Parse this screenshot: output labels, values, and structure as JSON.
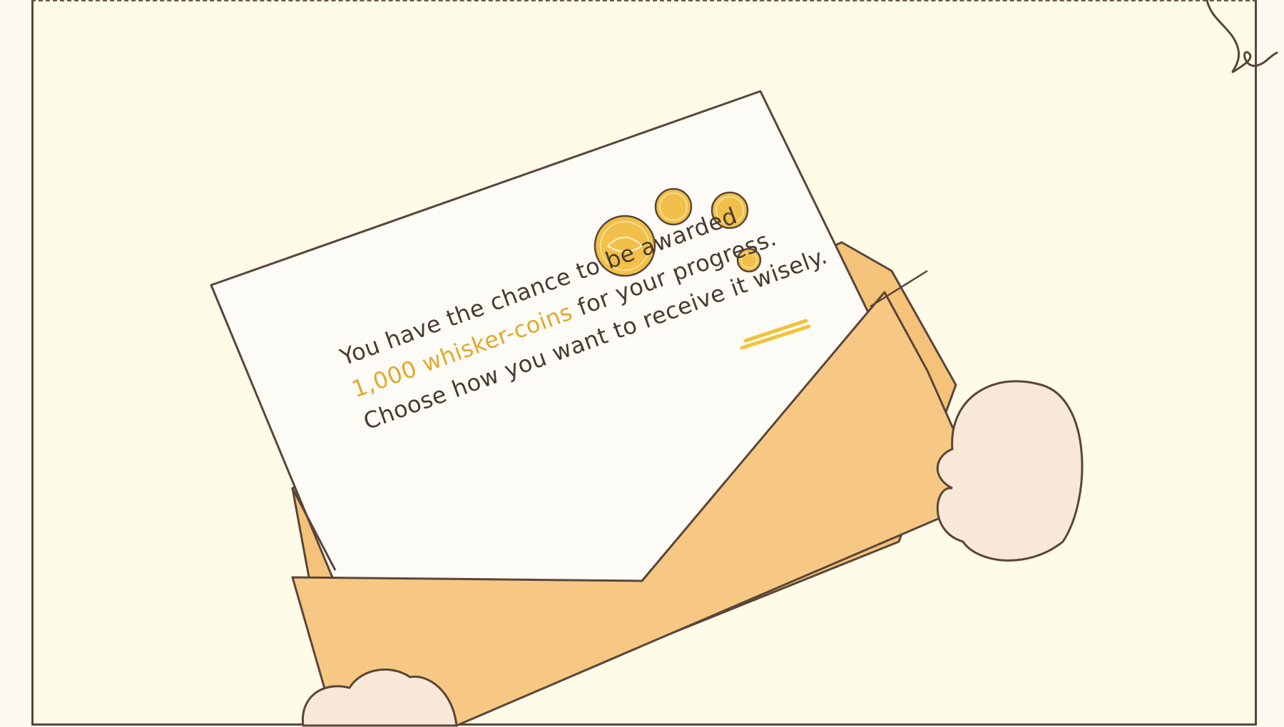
{
  "letter": {
    "line1": "You have the chance to be awarded",
    "line2_highlight": "1,000 whisker-coins",
    "line2_rest": " for your progress.",
    "line3_start": "Choose how you want to receive it ",
    "line3_underlined": "wisely."
  },
  "colors": {
    "background": "#fefbe8",
    "outline": "#5a4638",
    "envelope": "#f7c883",
    "letter_paper": "#fdfbf6",
    "coin": "#f1c04a",
    "paw": "#f7e8d8",
    "highlight_text": "#e0a92a",
    "body_text": "#4a3a2d"
  },
  "icons": [
    "coin-icon",
    "paw-icon",
    "curl-decoration-icon"
  ]
}
